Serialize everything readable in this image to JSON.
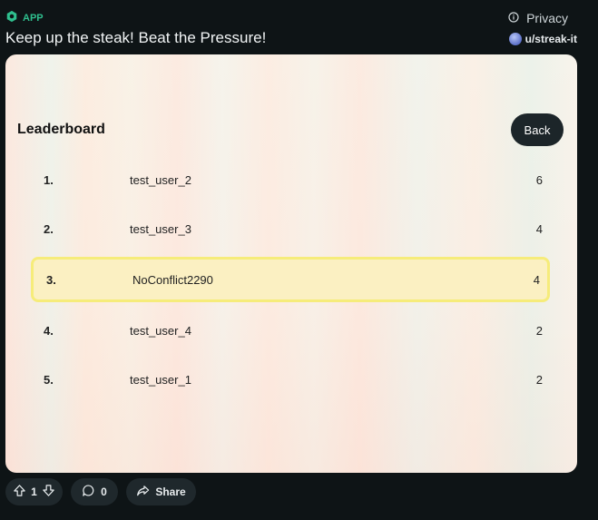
{
  "header": {
    "app_label": "APP",
    "post_title": "Keep up the steak! Beat the Pressure!",
    "privacy_label": "Privacy",
    "author": "u/streak-it"
  },
  "leaderboard": {
    "title": "Leaderboard",
    "back_label": "Back",
    "rows": [
      {
        "rank": "1.",
        "name": "test_user_2",
        "score": "6"
      },
      {
        "rank": "2.",
        "name": "test_user_3",
        "score": "4"
      },
      {
        "rank": "3.",
        "name": "NoConflict2290",
        "score": "4"
      },
      {
        "rank": "4.",
        "name": "test_user_4",
        "score": "2"
      },
      {
        "rank": "5.",
        "name": "test_user_1",
        "score": "2"
      }
    ]
  },
  "actions": {
    "vote_count": "1",
    "comment_count": "0",
    "share_label": "Share"
  },
  "colors": {
    "app_accent": "#2fbf8e",
    "highlight_fill": "#fbf0c2",
    "highlight_border": "#f6ec7a"
  }
}
